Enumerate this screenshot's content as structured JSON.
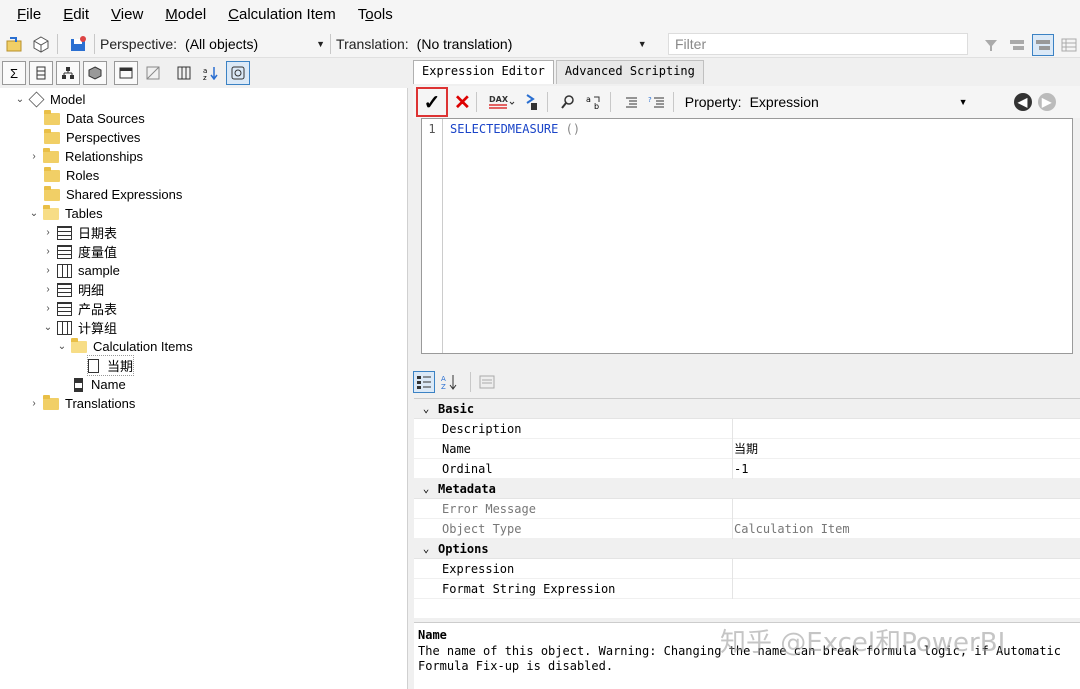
{
  "menu": [
    {
      "label": "File",
      "accel": "F",
      "rest": "ile"
    },
    {
      "label": "Edit",
      "accel": "E",
      "rest": "dit"
    },
    {
      "label": "View",
      "accel": "V",
      "rest": "iew"
    },
    {
      "label": "Model",
      "accel": "M",
      "rest": "odel"
    },
    {
      "label": "Calculation Item",
      "accel": "C",
      "rest": "alculation Item"
    },
    {
      "label": "Tools",
      "accel": "o",
      "pre": "T",
      "rest": "ols"
    }
  ],
  "toolbar": {
    "perspective_label": "Perspective:",
    "perspective_value": "(All objects)",
    "translation_label": "Translation:",
    "translation_value": "(No translation)",
    "filter_placeholder": "Filter"
  },
  "tree": {
    "model": "Model",
    "data_sources": "Data Sources",
    "perspectives": "Perspectives",
    "relationships": "Relationships",
    "roles": "Roles",
    "shared_expressions": "Shared Expressions",
    "tables": "Tables",
    "tables_list": [
      "日期表",
      "度量值",
      "sample",
      "明细",
      "产品表",
      "计算组"
    ],
    "calculation_items": "Calculation Items",
    "calc_item": "当期",
    "name_column": "Name",
    "translations": "Translations"
  },
  "tabs": {
    "expression_editor": "Expression Editor",
    "advanced_scripting": "Advanced Scripting"
  },
  "editor_toolbar": {
    "ok": "✓",
    "cancel": "✕",
    "dax": "DAX",
    "property_label": "Property:",
    "property_value": "Expression"
  },
  "editor": {
    "line_number": "1",
    "function": "SELECTEDMEASURE",
    "args": " ()"
  },
  "property_grid": {
    "basic": "Basic",
    "description": "Description",
    "name_label": "Name",
    "name_value": "当期",
    "ordinal_label": "Ordinal",
    "ordinal_value": "-1",
    "metadata": "Metadata",
    "error_message": "Error Message",
    "object_type_label": "Object Type",
    "object_type_value": "Calculation Item",
    "options": "Options",
    "expression": "Expression",
    "format_string_expression": "Format String Expression"
  },
  "description_panel": {
    "title": "Name",
    "text": "The name of this object. Warning: Changing the name can break formula logic, if Automatic Formula Fix-up is disabled."
  },
  "watermark": "知乎 @Excel和PowerBI",
  "colors": {
    "accent": "#3b82c4",
    "ok_border": "#dd3333",
    "cancel": "#dd0000",
    "function": "#1a44c8"
  }
}
